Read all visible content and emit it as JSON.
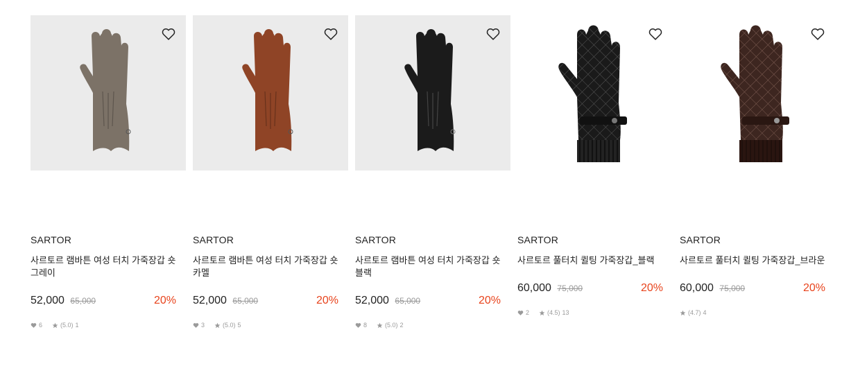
{
  "products": [
    {
      "brand": "SARTOR",
      "name": "사르토르 램바튼 여성 터치 가죽장갑 숏 그레이",
      "price": "52,000",
      "original_price": "65,000",
      "discount": "20%",
      "likes": "6",
      "rating": "(5.0)",
      "reviews": "1",
      "icon": "heart-outline-icon",
      "color": "#7c7267"
    },
    {
      "brand": "SARTOR",
      "name": "사르토르 램바튼 여성 터치 가죽장갑 숏 카멜",
      "price": "52,000",
      "original_price": "65,000",
      "discount": "20%",
      "likes": "3",
      "rating": "(5.0)",
      "reviews": "5",
      "icon": "heart-outline-icon",
      "color": "#8f4426"
    },
    {
      "brand": "SARTOR",
      "name": "사르토르 램바튼 여성 터치 가죽장갑 숏 블랙",
      "price": "52,000",
      "original_price": "65,000",
      "discount": "20%",
      "likes": "8",
      "rating": "(5.0)",
      "reviews": "2",
      "icon": "heart-outline-icon",
      "color": "#1b1b1b"
    },
    {
      "brand": "SARTOR",
      "name": "사르토르 풀터치 퀼팅 가죽장갑_블랙",
      "price": "60,000",
      "original_price": "75,000",
      "discount": "20%",
      "likes": "2",
      "rating": "(4.5)",
      "reviews": "13",
      "icon": "heart-outline-icon",
      "color": "#1a1a1a"
    },
    {
      "brand": "SARTOR",
      "name": "사르토르 풀터치 퀼팅 가죽장갑_브라운",
      "price": "60,000",
      "original_price": "75,000",
      "discount": "20%",
      "likes": "",
      "rating": "(4.7)",
      "reviews": "4",
      "icon": "heart-outline-icon",
      "color": "#3d2620"
    }
  ]
}
